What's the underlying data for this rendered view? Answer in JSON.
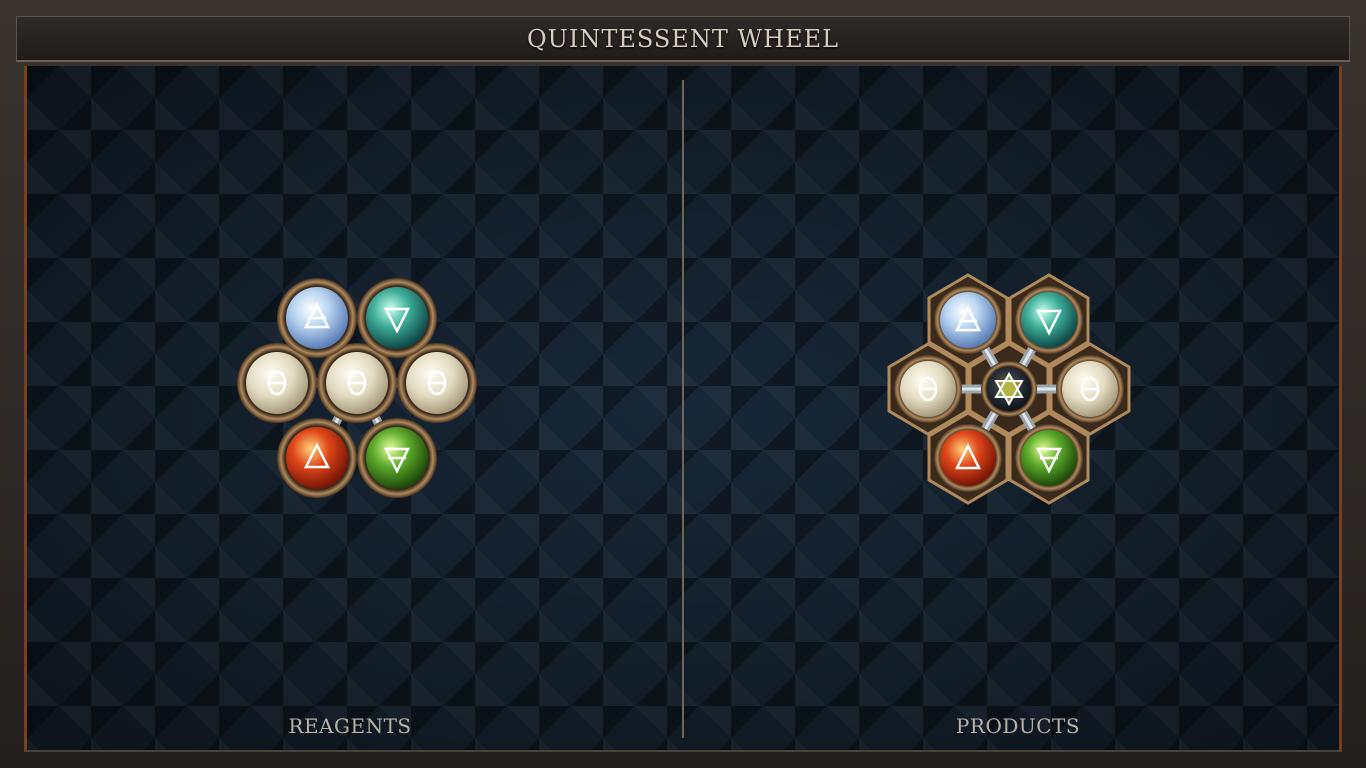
{
  "title": "QUINTESSENT WHEEL",
  "panels": {
    "left_label": "REAGENTS",
    "right_label": "PRODUCTS"
  },
  "icons": {
    "air": "air-triangle-icon",
    "water": "water-triangle-icon",
    "fire": "fire-triangle-icon",
    "earth": "earth-triangle-icon",
    "salt": "salt-theta-icon",
    "quintessence": "quintessence-star-icon"
  },
  "colors": {
    "air": "#bcd8f0",
    "water": "#3fae9a",
    "fire": "#e0471a",
    "earth": "#5caa2a",
    "salt": "#e4dcc2",
    "quintessence": "#2a2f3a",
    "metal": "#8a6a4a",
    "text": "#d6cdbf"
  }
}
